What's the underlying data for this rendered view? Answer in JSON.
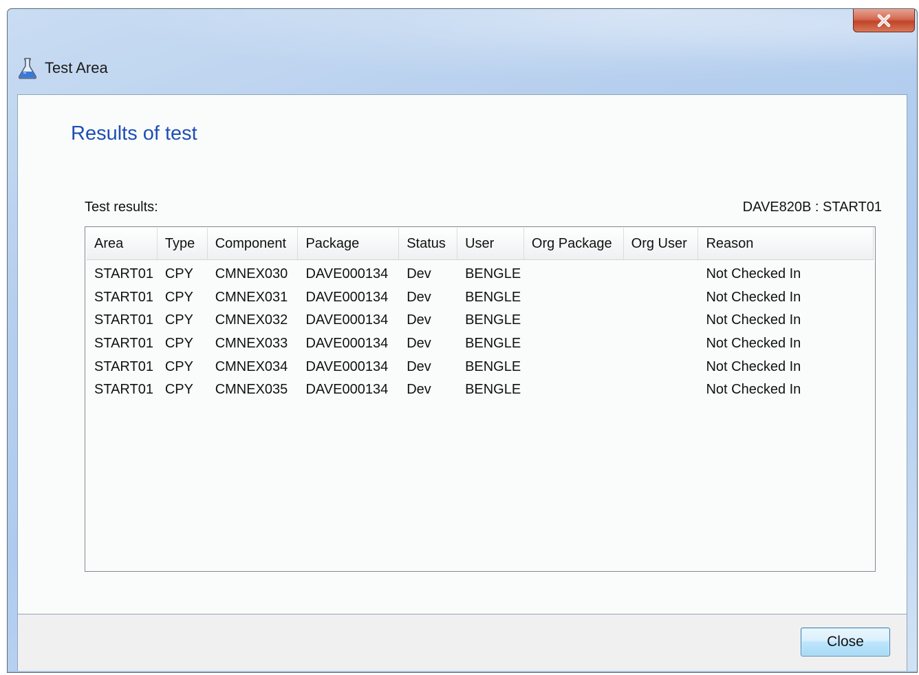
{
  "window": {
    "title": "Test Area",
    "icon": "flask-icon"
  },
  "title_close_icon": "close-x-icon",
  "heading": "Results of test",
  "results": {
    "label": "Test results:",
    "context": "DAVE820B : START01"
  },
  "table": {
    "columns": [
      "Area",
      "Type",
      "Component",
      "Package",
      "Status",
      "User",
      "Org Package",
      "Org User",
      "Reason"
    ],
    "rows": [
      [
        "START01",
        "CPY",
        "CMNEX030",
        "DAVE000134",
        "Dev",
        "BENGLE",
        "",
        "",
        "Not Checked In"
      ],
      [
        "START01",
        "CPY",
        "CMNEX031",
        "DAVE000134",
        "Dev",
        "BENGLE",
        "",
        "",
        "Not Checked In"
      ],
      [
        "START01",
        "CPY",
        "CMNEX032",
        "DAVE000134",
        "Dev",
        "BENGLE",
        "",
        "",
        "Not Checked In"
      ],
      [
        "START01",
        "CPY",
        "CMNEX033",
        "DAVE000134",
        "Dev",
        "BENGLE",
        "",
        "",
        "Not Checked In"
      ],
      [
        "START01",
        "CPY",
        "CMNEX034",
        "DAVE000134",
        "Dev",
        "BENGLE",
        "",
        "",
        "Not Checked In"
      ],
      [
        "START01",
        "CPY",
        "CMNEX035",
        "DAVE000134",
        "Dev",
        "BENGLE",
        "",
        "",
        "Not Checked In"
      ]
    ]
  },
  "footer": {
    "close_label": "Close"
  },
  "colors": {
    "heading": "#1e4fb4",
    "close_x": "#c04428",
    "button_border": "#3c7fb1"
  }
}
